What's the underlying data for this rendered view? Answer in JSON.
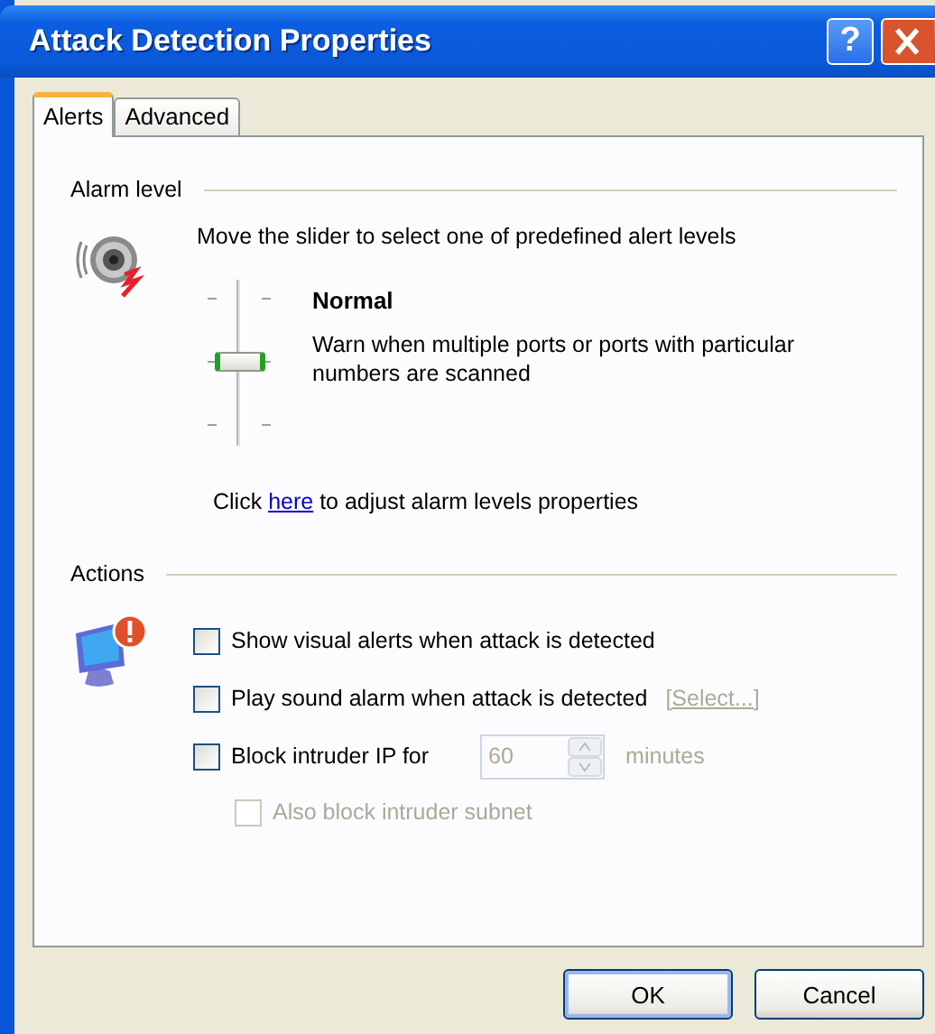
{
  "window": {
    "title": "Attack Detection Properties",
    "help_button": "?"
  },
  "tabs": [
    {
      "label": "Alerts",
      "selected": true
    },
    {
      "label": "Advanced",
      "selected": false
    }
  ],
  "alarm_level": {
    "heading": "Alarm level",
    "description": "Move the slider to select one of predefined alert levels",
    "slider": {
      "level": 0.5
    },
    "level_name": "Normal",
    "level_description": "Warn when multiple ports or ports with particular numbers are scanned",
    "link_prefix": "Click ",
    "link": "here",
    "link_suffix": " to adjust alarm levels properties"
  },
  "actions": {
    "heading": "Actions",
    "options": [
      {
        "kind": "checkbox",
        "label": "Show visual alerts when attack is detected",
        "checked": false,
        "disabled": false
      },
      {
        "kind": "checkbox_link",
        "label": "Play sound alarm when attack is detected",
        "checked": false,
        "disabled": false,
        "link": "[Select...]",
        "link_disabled": true
      },
      {
        "kind": "checkbox_spinner",
        "label": "Block intruder IP for",
        "checked": false,
        "disabled": false,
        "value": "60",
        "unit": "minutes",
        "spinner_disabled": true
      },
      {
        "kind": "sub_checkbox",
        "label": "Also block intruder subnet",
        "checked": false,
        "disabled": true
      }
    ]
  },
  "buttons": [
    {
      "label": "OK",
      "default": true
    },
    {
      "label": "Cancel",
      "default": false
    }
  ]
}
